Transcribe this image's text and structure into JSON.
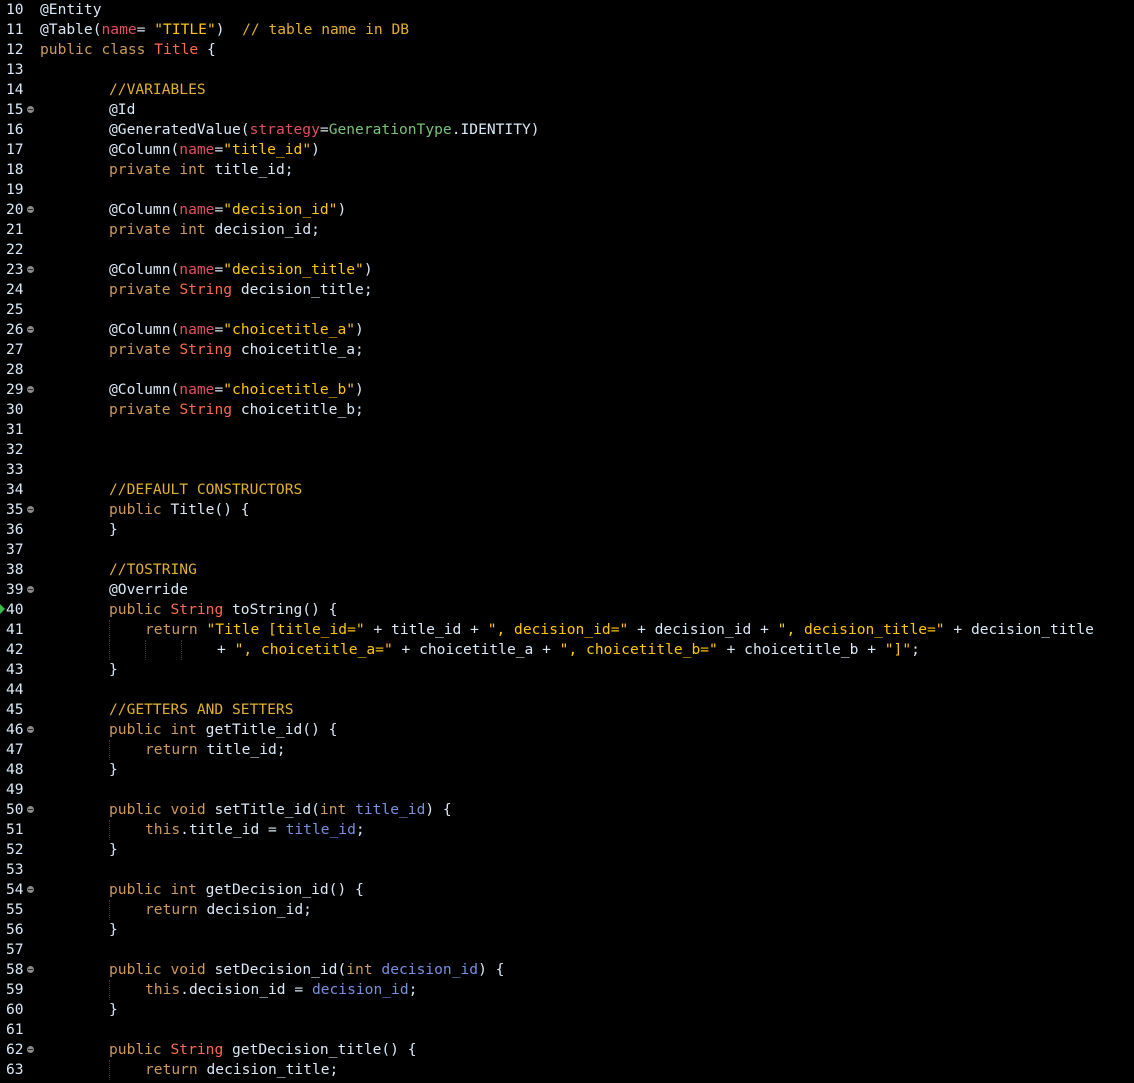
{
  "editor": {
    "language": "java",
    "lines": [
      {
        "n": "10",
        "tokens": [
          [
            "ann",
            "@Entity"
          ]
        ]
      },
      {
        "n": "11",
        "tokens": [
          [
            "ann",
            "@Table("
          ],
          [
            "attr",
            "name"
          ],
          [
            "plain",
            "= "
          ],
          [
            "str",
            "\"TITLE\""
          ],
          [
            "plain",
            ")  "
          ],
          [
            "com",
            "// table name in DB"
          ]
        ]
      },
      {
        "n": "12",
        "tokens": [
          [
            "kw",
            "public"
          ],
          [
            "plain",
            " "
          ],
          [
            "kw",
            "class"
          ],
          [
            "plain",
            " "
          ],
          [
            "type",
            "Title"
          ],
          [
            "plain",
            " {"
          ]
        ]
      },
      {
        "n": "13",
        "tokens": []
      },
      {
        "n": "14",
        "indent": 1,
        "tokens": [
          [
            "com",
            "//VARIABLES"
          ]
        ]
      },
      {
        "n": "15",
        "fold": true,
        "indent": 1,
        "tokens": [
          [
            "ann",
            "@Id"
          ]
        ]
      },
      {
        "n": "16",
        "indent": 1,
        "tokens": [
          [
            "ann",
            "@GeneratedValue("
          ],
          [
            "attr",
            "strategy"
          ],
          [
            "plain",
            "="
          ],
          [
            "enum",
            "GenerationType"
          ],
          [
            "plain",
            "."
          ],
          [
            "ann",
            "IDENTITY"
          ],
          [
            "plain",
            ")"
          ]
        ]
      },
      {
        "n": "17",
        "indent": 1,
        "tokens": [
          [
            "ann",
            "@Column("
          ],
          [
            "attr",
            "name"
          ],
          [
            "plain",
            "="
          ],
          [
            "str",
            "\"title_id\""
          ],
          [
            "plain",
            ")"
          ]
        ]
      },
      {
        "n": "18",
        "indent": 1,
        "tokens": [
          [
            "kw",
            "private"
          ],
          [
            "plain",
            " "
          ],
          [
            "kw",
            "int"
          ],
          [
            "plain",
            " title_id;"
          ]
        ]
      },
      {
        "n": "19",
        "tokens": []
      },
      {
        "n": "20",
        "fold": true,
        "indent": 1,
        "tokens": [
          [
            "ann",
            "@Column("
          ],
          [
            "attr",
            "name"
          ],
          [
            "plain",
            "="
          ],
          [
            "str",
            "\"decision_id\""
          ],
          [
            "plain",
            ")"
          ]
        ]
      },
      {
        "n": "21",
        "indent": 1,
        "tokens": [
          [
            "kw",
            "private"
          ],
          [
            "plain",
            " "
          ],
          [
            "kw",
            "int"
          ],
          [
            "plain",
            " decision_id;"
          ]
        ]
      },
      {
        "n": "22",
        "tokens": []
      },
      {
        "n": "23",
        "fold": true,
        "indent": 1,
        "tokens": [
          [
            "ann",
            "@Column("
          ],
          [
            "attr",
            "name"
          ],
          [
            "plain",
            "="
          ],
          [
            "str",
            "\"decision_title\""
          ],
          [
            "plain",
            ")"
          ]
        ]
      },
      {
        "n": "24",
        "indent": 1,
        "tokens": [
          [
            "kw",
            "private"
          ],
          [
            "plain",
            " "
          ],
          [
            "type",
            "String"
          ],
          [
            "plain",
            " decision_title;"
          ]
        ]
      },
      {
        "n": "25",
        "tokens": []
      },
      {
        "n": "26",
        "fold": true,
        "indent": 1,
        "tokens": [
          [
            "ann",
            "@Column("
          ],
          [
            "attr",
            "name"
          ],
          [
            "plain",
            "="
          ],
          [
            "str",
            "\"choicetitle_a\""
          ],
          [
            "plain",
            ")"
          ]
        ]
      },
      {
        "n": "27",
        "indent": 1,
        "tokens": [
          [
            "kw",
            "private"
          ],
          [
            "plain",
            " "
          ],
          [
            "type",
            "String"
          ],
          [
            "plain",
            " choicetitle_a;"
          ]
        ]
      },
      {
        "n": "28",
        "tokens": []
      },
      {
        "n": "29",
        "fold": true,
        "indent": 1,
        "tokens": [
          [
            "ann",
            "@Column("
          ],
          [
            "attr",
            "name"
          ],
          [
            "plain",
            "="
          ],
          [
            "str",
            "\"choicetitle_b\""
          ],
          [
            "plain",
            ")"
          ]
        ]
      },
      {
        "n": "30",
        "indent": 1,
        "tokens": [
          [
            "kw",
            "private"
          ],
          [
            "plain",
            " "
          ],
          [
            "type",
            "String"
          ],
          [
            "plain",
            " choicetitle_b;"
          ]
        ]
      },
      {
        "n": "31",
        "tokens": []
      },
      {
        "n": "32",
        "tokens": []
      },
      {
        "n": "33",
        "tokens": []
      },
      {
        "n": "34",
        "indent": 1,
        "tokens": [
          [
            "com",
            "//DEFAULT CONSTRUCTORS"
          ]
        ]
      },
      {
        "n": "35",
        "fold": true,
        "indent": 1,
        "tokens": [
          [
            "kw",
            "public"
          ],
          [
            "plain",
            " Title() {"
          ]
        ]
      },
      {
        "n": "36",
        "indent": 1,
        "tokens": [
          [
            "plain",
            "}"
          ]
        ]
      },
      {
        "n": "37",
        "tokens": []
      },
      {
        "n": "38",
        "indent": 1,
        "tokens": [
          [
            "com",
            "//TOSTRING"
          ]
        ]
      },
      {
        "n": "39",
        "fold": true,
        "indent": 1,
        "tokens": [
          [
            "ann",
            "@Override"
          ]
        ]
      },
      {
        "n": "40",
        "marker": true,
        "indent": 1,
        "tokens": [
          [
            "kw",
            "public"
          ],
          [
            "plain",
            " "
          ],
          [
            "type",
            "String"
          ],
          [
            "plain",
            " toString() {"
          ]
        ]
      },
      {
        "n": "41",
        "indent": 2,
        "tokens": [
          [
            "kw",
            "return"
          ],
          [
            "plain",
            " "
          ],
          [
            "str",
            "\"Title [title_id=\""
          ],
          [
            "plain",
            " + title_id + "
          ],
          [
            "str",
            "\", decision_id=\""
          ],
          [
            "plain",
            " + decision_id + "
          ],
          [
            "str",
            "\", decision_title=\""
          ],
          [
            "plain",
            " + decision_title"
          ]
        ]
      },
      {
        "n": "42",
        "indent": 4,
        "tokens": [
          [
            "plain",
            "+ "
          ],
          [
            "str",
            "\", choicetitle_a=\""
          ],
          [
            "plain",
            " + choicetitle_a + "
          ],
          [
            "str",
            "\", choicetitle_b=\""
          ],
          [
            "plain",
            " + choicetitle_b + "
          ],
          [
            "str",
            "\"]\""
          ],
          [
            "plain",
            ";"
          ]
        ]
      },
      {
        "n": "43",
        "indent": 1,
        "tokens": [
          [
            "plain",
            "}"
          ]
        ]
      },
      {
        "n": "44",
        "tokens": []
      },
      {
        "n": "45",
        "indent": 1,
        "tokens": [
          [
            "com",
            "//GETTERS AND SETTERS"
          ]
        ]
      },
      {
        "n": "46",
        "fold": true,
        "indent": 1,
        "tokens": [
          [
            "kw",
            "public"
          ],
          [
            "plain",
            " "
          ],
          [
            "kw",
            "int"
          ],
          [
            "plain",
            " getTitle_id() {"
          ]
        ]
      },
      {
        "n": "47",
        "indent": 2,
        "tokens": [
          [
            "kw",
            "return"
          ],
          [
            "plain",
            " title_id;"
          ]
        ]
      },
      {
        "n": "48",
        "indent": 1,
        "tokens": [
          [
            "plain",
            "}"
          ]
        ]
      },
      {
        "n": "49",
        "tokens": []
      },
      {
        "n": "50",
        "fold": true,
        "indent": 1,
        "tokens": [
          [
            "kw",
            "public"
          ],
          [
            "plain",
            " "
          ],
          [
            "kw",
            "void"
          ],
          [
            "plain",
            " setTitle_id("
          ],
          [
            "kw",
            "int"
          ],
          [
            "plain",
            " "
          ],
          [
            "param",
            "title_id"
          ],
          [
            "plain",
            ") {"
          ]
        ]
      },
      {
        "n": "51",
        "indent": 2,
        "tokens": [
          [
            "kw",
            "this"
          ],
          [
            "plain",
            ".title_id = "
          ],
          [
            "param",
            "title_id"
          ],
          [
            "plain",
            ";"
          ]
        ]
      },
      {
        "n": "52",
        "indent": 1,
        "tokens": [
          [
            "plain",
            "}"
          ]
        ]
      },
      {
        "n": "53",
        "tokens": []
      },
      {
        "n": "54",
        "fold": true,
        "indent": 1,
        "tokens": [
          [
            "kw",
            "public"
          ],
          [
            "plain",
            " "
          ],
          [
            "kw",
            "int"
          ],
          [
            "plain",
            " getDecision_id() {"
          ]
        ]
      },
      {
        "n": "55",
        "indent": 2,
        "tokens": [
          [
            "kw",
            "return"
          ],
          [
            "plain",
            " decision_id;"
          ]
        ]
      },
      {
        "n": "56",
        "indent": 1,
        "tokens": [
          [
            "plain",
            "}"
          ]
        ]
      },
      {
        "n": "57",
        "tokens": []
      },
      {
        "n": "58",
        "fold": true,
        "indent": 1,
        "tokens": [
          [
            "kw",
            "public"
          ],
          [
            "plain",
            " "
          ],
          [
            "kw",
            "void"
          ],
          [
            "plain",
            " setDecision_id("
          ],
          [
            "kw",
            "int"
          ],
          [
            "plain",
            " "
          ],
          [
            "param",
            "decision_id"
          ],
          [
            "plain",
            ") {"
          ]
        ]
      },
      {
        "n": "59",
        "indent": 2,
        "tokens": [
          [
            "kw",
            "this"
          ],
          [
            "plain",
            ".decision_id = "
          ],
          [
            "param",
            "decision_id"
          ],
          [
            "plain",
            ";"
          ]
        ]
      },
      {
        "n": "60",
        "indent": 1,
        "tokens": [
          [
            "plain",
            "}"
          ]
        ]
      },
      {
        "n": "61",
        "tokens": []
      },
      {
        "n": "62",
        "fold": true,
        "indent": 1,
        "tokens": [
          [
            "kw",
            "public"
          ],
          [
            "plain",
            " "
          ],
          [
            "type",
            "String"
          ],
          [
            "plain",
            " getDecision_title() {"
          ]
        ]
      },
      {
        "n": "63",
        "indent": 2,
        "tokens": [
          [
            "kw",
            "return"
          ],
          [
            "plain",
            " decision_title;"
          ]
        ]
      }
    ]
  },
  "colors": {
    "background": "#000000",
    "plain": "#d9e8f7",
    "keyword": "#cd9a5b",
    "string": "#ffc600",
    "comment": "#e0b030",
    "type": "#ff6a4d",
    "attribute": "#e05060",
    "enum": "#79c279",
    "parameter": "#7990e0",
    "change_marker": "#3dba4e"
  }
}
